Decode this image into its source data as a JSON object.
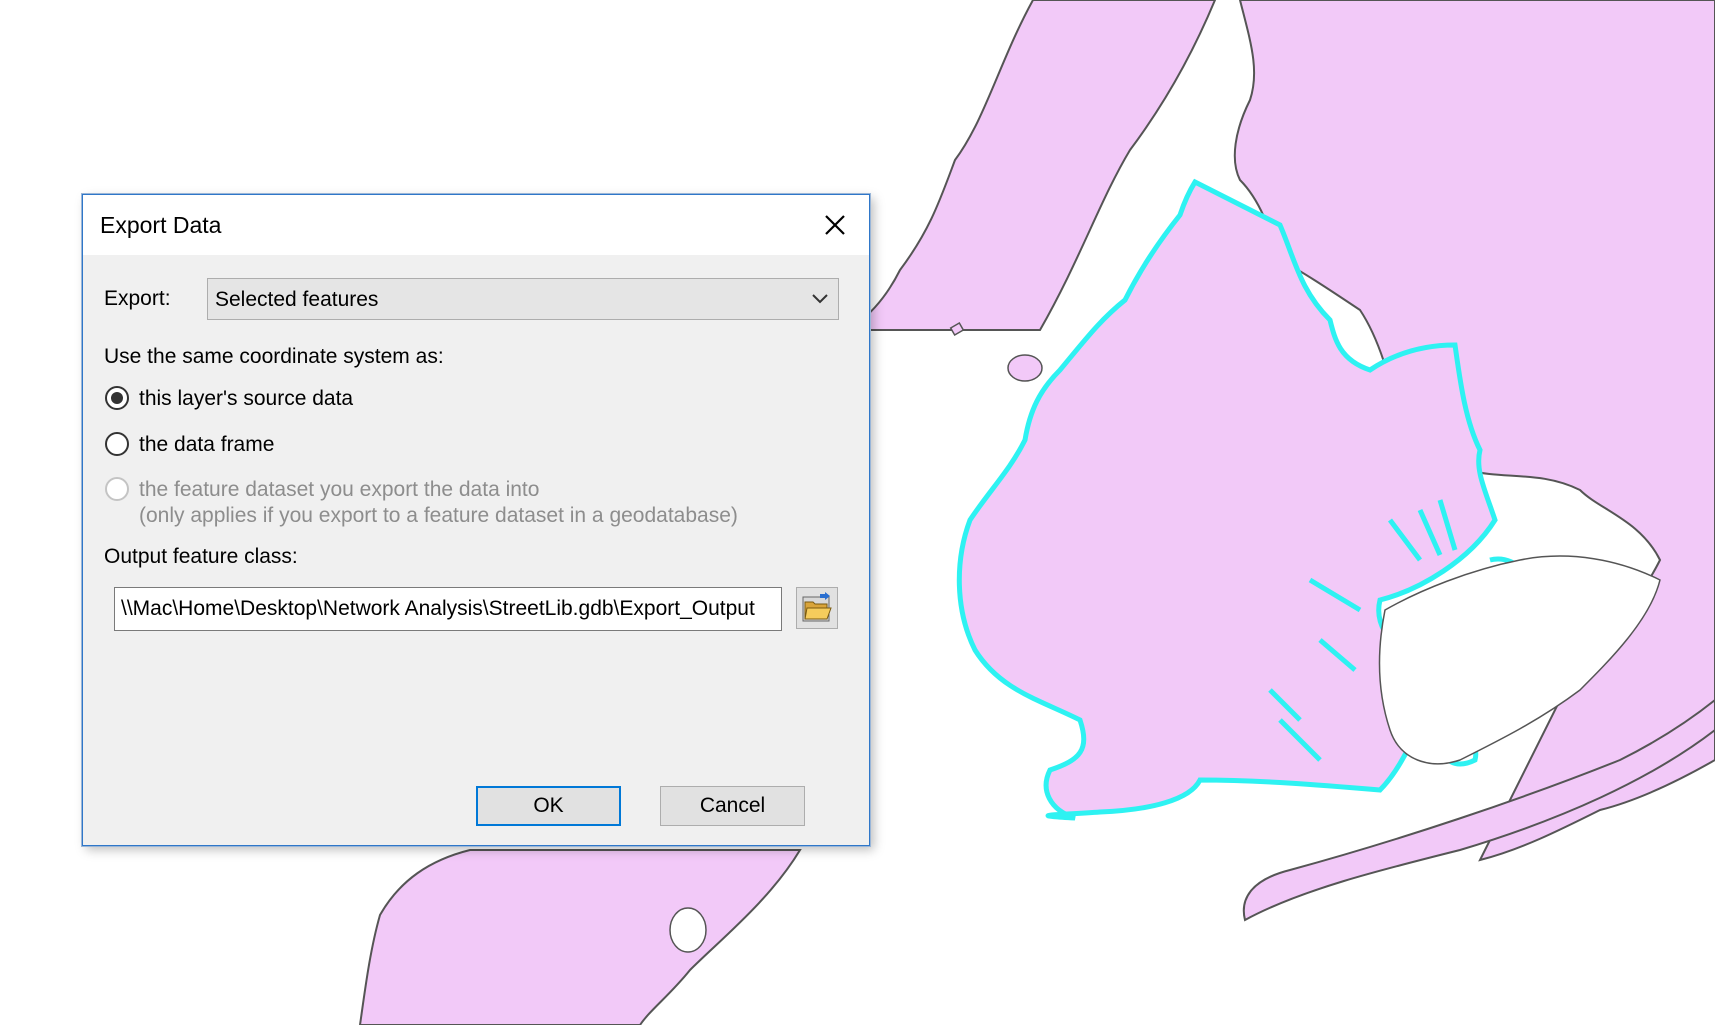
{
  "dialog": {
    "title": "Export Data",
    "export_label": "Export:",
    "export_value": "Selected features",
    "coord_heading": "Use the same coordinate system as:",
    "options": [
      {
        "label": "this layer's source data",
        "checked": true,
        "enabled": true
      },
      {
        "label": "the data frame",
        "checked": false,
        "enabled": true
      },
      {
        "label": "the feature dataset you export the data into",
        "sublabel": "(only applies if you export to a feature dataset in a geodatabase)",
        "checked": false,
        "enabled": false
      }
    ],
    "output_label": "Output feature class:",
    "output_value": "\\\\Mac\\Home\\Desktop\\Network Analysis\\StreetLib.gdb\\Export_Output",
    "ok_label": "OK",
    "cancel_label": "Cancel"
  },
  "colors": {
    "land_fill": "#f2c9f8",
    "land_outline": "#555555",
    "selection_outline": "#2ef2f2",
    "dialog_border": "#2f77c9",
    "default_button_border": "#0078d7"
  },
  "icons": [
    "close-icon",
    "chevron-down-icon",
    "folder-open-icon"
  ]
}
